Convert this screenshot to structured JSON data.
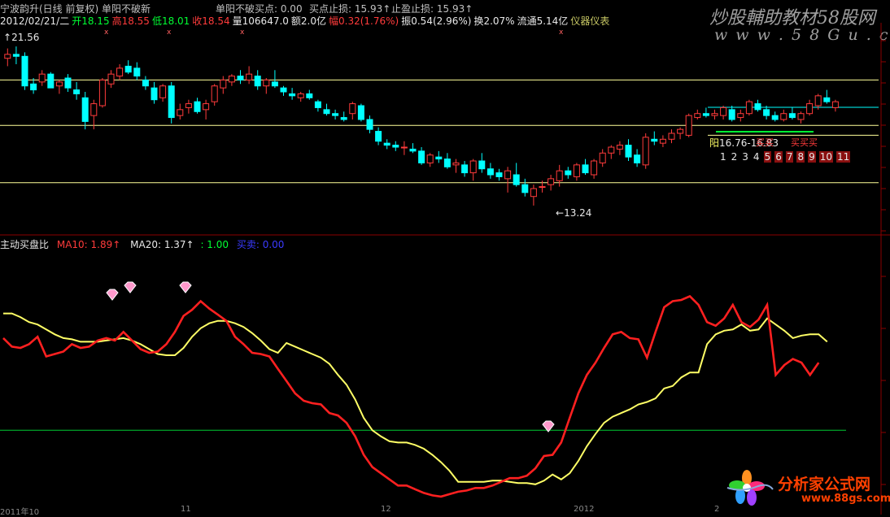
{
  "header": {
    "line1": [
      {
        "text": "宁波韵升(日线 前复权) 单阳不破新",
        "color": "#e8e8e8"
      },
      {
        "text": "单阳不破买点: 0.00",
        "color": "#ff3b3b"
      },
      {
        "text": "买点止损: 15.93↑",
        "color": "#00ff33"
      },
      {
        "text": "止盈止损: 15.93↑",
        "color": "#00ffff"
      }
    ],
    "line2": [
      {
        "label": "2012/02/21/二",
        "color": "#e8e8e8"
      },
      {
        "label": "开18.15",
        "color": "#00ff33"
      },
      {
        "label": "高18.55",
        "color": "#ff3b3b"
      },
      {
        "label": "低18.01",
        "color": "#00ff33"
      },
      {
        "label": "收18.54",
        "color": "#ff3b3b"
      },
      {
        "label": "量106647.0",
        "color": "#e8e8e8"
      },
      {
        "label": "额2.0亿",
        "color": "#e8e8e8"
      },
      {
        "label": "幅0.32(1.76%)",
        "color": "#ff3b3b"
      },
      {
        "label": "振0.54(2.96%)",
        "color": "#e8e8e8"
      },
      {
        "label": "换2.07%",
        "color": "#e8e8e8"
      },
      {
        "label": "流通5.14亿",
        "color": "#e8e8e8"
      },
      {
        "label": "仪器仪表",
        "color": "#c8c864"
      }
    ]
  },
  "watermark_top": {
    "line1": "炒股輔助教材58股网",
    "line2": "w w w . 5 8 G u . c o m"
  },
  "watermark_bottom": {
    "line1": "分析家公式网",
    "line2": "www.88gs.com"
  },
  "indicator": {
    "title": "主动买盘比",
    "ma10": "MA10: 1.89↑",
    "ma20": "MA20: 1.37↑",
    "level": ": 1.00",
    "extra": "买卖: 0.00"
  },
  "price_annotations": {
    "high": "21.56",
    "low": "13.24",
    "range": "16.76-16.83",
    "range_mark": "阳"
  },
  "zone_labels": {
    "label1": "买买",
    "label2": "买买买",
    "counts": "1 2 3 4 5 6 7 8 9 10 11"
  },
  "axis_dates": [
    "2011年10",
    "11",
    "12",
    "2012",
    "2"
  ],
  "chart_data": [
    {
      "type": "candlestick",
      "title": "宁波韵升(日线 前复权)",
      "ylim": [
        12.0,
        22.5
      ],
      "hlines": [
        19.6,
        17.3,
        14.4,
        16.8
      ],
      "candles": [
        [
          20.7,
          21.2,
          20.3,
          20.9
        ],
        [
          20.9,
          21.3,
          20.4,
          20.8
        ],
        [
          20.8,
          21.0,
          19.1,
          19.3
        ],
        [
          19.4,
          19.7,
          18.9,
          19.1
        ],
        [
          19.5,
          20.1,
          19.3,
          19.9
        ],
        [
          19.9,
          20.0,
          19.2,
          19.2
        ],
        [
          19.3,
          19.6,
          18.9,
          19.5
        ],
        [
          19.7,
          19.9,
          19.0,
          19.2
        ],
        [
          19.1,
          19.5,
          18.6,
          18.9
        ],
        [
          18.7,
          19.0,
          17.1,
          17.5
        ],
        [
          17.8,
          18.6,
          17.1,
          18.4
        ],
        [
          18.3,
          19.7,
          18.2,
          19.6
        ],
        [
          19.4,
          20.1,
          19.2,
          19.9
        ],
        [
          19.8,
          20.4,
          19.6,
          20.2
        ],
        [
          20.3,
          20.6,
          19.9,
          20.0
        ],
        [
          20.2,
          20.5,
          19.6,
          19.8
        ],
        [
          19.6,
          19.8,
          19.1,
          19.3
        ],
        [
          19.2,
          19.5,
          18.4,
          18.6
        ],
        [
          18.7,
          19.4,
          18.5,
          19.3
        ],
        [
          19.3,
          19.5,
          17.4,
          17.7
        ],
        [
          17.8,
          18.4,
          17.6,
          18.1
        ],
        [
          18.2,
          18.6,
          17.9,
          18.4
        ],
        [
          18.5,
          18.7,
          17.9,
          18.0
        ],
        [
          18.1,
          18.6,
          17.6,
          18.4
        ],
        [
          18.5,
          19.4,
          18.3,
          19.3
        ],
        [
          19.2,
          19.8,
          18.9,
          19.6
        ],
        [
          19.5,
          19.9,
          19.3,
          19.8
        ],
        [
          19.8,
          20.1,
          19.4,
          19.6
        ],
        [
          19.6,
          20.3,
          19.4,
          19.9
        ],
        [
          19.8,
          20.1,
          19.1,
          19.3
        ],
        [
          19.3,
          19.7,
          18.9,
          19.6
        ],
        [
          19.5,
          20.1,
          19.2,
          19.3
        ],
        [
          19.2,
          19.3,
          18.8,
          19.0
        ],
        [
          18.9,
          19.2,
          18.6,
          18.8
        ],
        [
          18.7,
          19.0,
          18.5,
          18.9
        ],
        [
          18.9,
          19.1,
          18.6,
          18.7
        ],
        [
          18.5,
          18.6,
          18.0,
          18.2
        ],
        [
          18.1,
          18.4,
          17.8,
          17.9
        ],
        [
          17.9,
          18.1,
          17.6,
          17.8
        ],
        [
          17.7,
          18.0,
          17.5,
          17.6
        ],
        [
          17.9,
          18.5,
          17.6,
          18.4
        ],
        [
          18.3,
          18.4,
          17.5,
          17.6
        ],
        [
          17.6,
          17.8,
          16.9,
          17.1
        ],
        [
          17.0,
          17.2,
          16.3,
          16.5
        ],
        [
          16.4,
          16.6,
          16.1,
          16.3
        ],
        [
          16.3,
          16.5,
          16.0,
          16.2
        ],
        [
          16.2,
          16.5,
          15.8,
          16.2
        ],
        [
          16.1,
          16.4,
          15.9,
          16.0
        ],
        [
          16.0,
          16.2,
          15.3,
          15.4
        ],
        [
          15.4,
          15.9,
          15.2,
          15.8
        ],
        [
          15.7,
          16.0,
          15.4,
          15.6
        ],
        [
          15.6,
          15.9,
          15.1,
          15.2
        ],
        [
          15.3,
          15.6,
          14.9,
          15.4
        ],
        [
          15.3,
          15.5,
          14.7,
          14.9
        ],
        [
          14.9,
          15.6,
          14.5,
          15.5
        ],
        [
          15.5,
          15.9,
          14.9,
          15.1
        ],
        [
          15.1,
          15.4,
          14.6,
          14.8
        ],
        [
          14.9,
          15.1,
          14.5,
          14.7
        ],
        [
          14.6,
          15.2,
          13.9,
          15.0
        ],
        [
          14.8,
          15.4,
          14.2,
          14.3
        ],
        [
          14.3,
          14.6,
          13.7,
          13.9
        ],
        [
          13.7,
          14.3,
          13.24,
          14.1
        ],
        [
          14.2,
          14.5,
          13.9,
          14.2
        ],
        [
          14.3,
          14.8,
          14.0,
          14.6
        ],
        [
          14.5,
          15.3,
          14.2,
          15.0
        ],
        [
          15.0,
          15.2,
          14.6,
          14.8
        ],
        [
          14.7,
          15.4,
          14.5,
          15.3
        ],
        [
          15.3,
          15.6,
          14.8,
          14.9
        ],
        [
          14.8,
          15.6,
          14.6,
          15.5
        ],
        [
          15.4,
          16.1,
          15.2,
          15.9
        ],
        [
          15.9,
          16.3,
          15.6,
          16.2
        ],
        [
          16.1,
          16.5,
          15.8,
          16.3
        ],
        [
          16.3,
          16.6,
          15.5,
          15.7
        ],
        [
          15.8,
          16.1,
          15.2,
          15.4
        ],
        [
          15.3,
          16.9,
          15.1,
          16.7
        ],
        [
          16.6,
          17.0,
          16.3,
          16.5
        ],
        [
          16.4,
          16.8,
          16.2,
          16.6
        ],
        [
          16.6,
          17.1,
          16.4,
          16.9
        ],
        [
          16.9,
          17.2,
          16.6,
          17.1
        ],
        [
          16.8,
          17.9,
          16.7,
          17.8
        ],
        [
          17.7,
          18.1,
          17.6,
          17.9
        ],
        [
          17.9,
          18.2,
          17.7,
          17.8
        ],
        [
          17.8,
          18.1,
          17.6,
          17.9
        ],
        [
          17.8,
          18.3,
          17.6,
          18.2
        ],
        [
          18.1,
          18.3,
          17.5,
          17.6
        ],
        [
          17.7,
          18.1,
          17.5,
          17.9
        ],
        [
          17.9,
          18.6,
          17.8,
          18.5
        ],
        [
          18.4,
          18.6,
          18.0,
          18.1
        ],
        [
          18.1,
          18.3,
          17.6,
          17.8
        ],
        [
          17.8,
          18.0,
          17.5,
          17.6
        ],
        [
          17.6,
          18.1,
          17.5,
          17.9
        ],
        [
          17.9,
          18.2,
          17.6,
          17.7
        ],
        [
          17.6,
          18.0,
          17.4,
          17.9
        ],
        [
          17.9,
          18.6,
          17.8,
          18.4
        ],
        [
          18.3,
          18.9,
          18.1,
          18.8
        ],
        [
          18.7,
          19.1,
          18.4,
          18.5
        ],
        [
          18.2,
          18.6,
          18.0,
          18.5
        ]
      ]
    },
    {
      "type": "line",
      "title": "主动买盘比",
      "ylim": [
        0.4,
        2.45
      ],
      "hline": 1.0,
      "series": [
        {
          "name": "MA10",
          "color": "#ff2020",
          "values": [
            1.75,
            1.68,
            1.67,
            1.7,
            1.76,
            1.6,
            1.62,
            1.64,
            1.7,
            1.67,
            1.68,
            1.73,
            1.75,
            1.73,
            1.8,
            1.73,
            1.66,
            1.63,
            1.64,
            1.7,
            1.8,
            1.93,
            1.98,
            2.05,
            1.99,
            1.94,
            1.89,
            1.76,
            1.7,
            1.63,
            1.62,
            1.6,
            1.5,
            1.4,
            1.3,
            1.24,
            1.22,
            1.21,
            1.14,
            1.12,
            1.06,
            0.95,
            0.8,
            0.7,
            0.65,
            0.6,
            0.55,
            0.55,
            0.52,
            0.49,
            0.47,
            0.46,
            0.48,
            0.5,
            0.51,
            0.53,
            0.53,
            0.55,
            0.58,
            0.61,
            0.61,
            0.63,
            0.69,
            0.79,
            0.8,
            0.9,
            1.1,
            1.3,
            1.45,
            1.55,
            1.67,
            1.78,
            1.8,
            1.75,
            1.74,
            1.59,
            1.8,
            2.0,
            2.05,
            2.06,
            2.09,
            2.02,
            1.88,
            1.85,
            1.91,
            2.02,
            1.88,
            1.84,
            1.9,
            2.02,
            1.45,
            1.53,
            1.58,
            1.55,
            1.45,
            1.55
          ]
        },
        {
          "name": "MA20",
          "color": "#ffff66",
          "values": [
            1.95,
            1.95,
            1.92,
            1.88,
            1.86,
            1.82,
            1.78,
            1.75,
            1.74,
            1.72,
            1.72,
            1.72,
            1.73,
            1.74,
            1.75,
            1.73,
            1.7,
            1.66,
            1.62,
            1.61,
            1.61,
            1.67,
            1.76,
            1.83,
            1.87,
            1.89,
            1.89,
            1.87,
            1.84,
            1.79,
            1.73,
            1.66,
            1.63,
            1.71,
            1.68,
            1.65,
            1.62,
            1.59,
            1.54,
            1.45,
            1.37,
            1.25,
            1.1,
            1.0,
            0.95,
            0.91,
            0.9,
            0.9,
            0.88,
            0.85,
            0.8,
            0.74,
            0.67,
            0.58,
            0.58,
            0.58,
            0.58,
            0.59,
            0.59,
            0.58,
            0.57,
            0.57,
            0.56,
            0.59,
            0.64,
            0.6,
            0.65,
            0.75,
            0.87,
            0.97,
            1.06,
            1.11,
            1.14,
            1.17,
            1.21,
            1.23,
            1.26,
            1.34,
            1.36,
            1.43,
            1.47,
            1.47,
            1.7,
            1.78,
            1.81,
            1.82,
            1.86,
            1.81,
            1.82,
            1.91,
            1.86,
            1.81,
            1.75,
            1.77,
            1.78,
            1.78,
            1.72
          ]
        }
      ]
    }
  ]
}
